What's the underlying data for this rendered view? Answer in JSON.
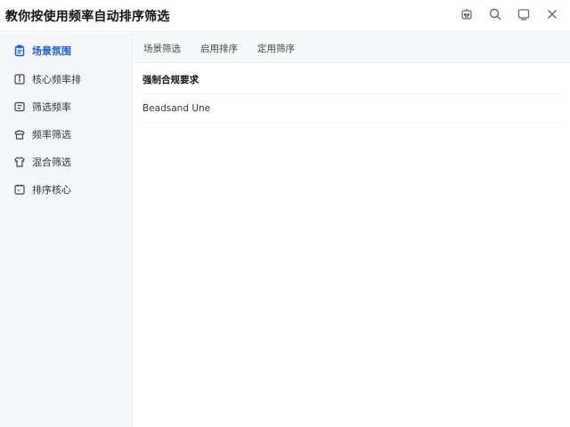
{
  "window": {
    "title": "教你按使用频率自动排序筛选"
  },
  "titlebar_icons": [
    "robot-icon",
    "search-icon",
    "window-icon",
    "close-icon"
  ],
  "sidebar": {
    "items": [
      {
        "label": "场景氛围",
        "icon": "clipboard-icon",
        "active": true
      },
      {
        "label": "核心频率排",
        "icon": "info-square-icon",
        "active": false
      },
      {
        "label": "筛选频率",
        "icon": "chat-square-icon",
        "active": false
      },
      {
        "label": "频率筛选",
        "icon": "hat-icon",
        "active": false
      },
      {
        "label": "混合筛选",
        "icon": "shirt-icon",
        "active": false
      },
      {
        "label": "排序核心",
        "icon": "calendar-icon",
        "active": false
      }
    ]
  },
  "tabs": [
    {
      "label": "场景筛选"
    },
    {
      "label": "启用排序"
    },
    {
      "label": "定用筛序"
    }
  ],
  "content": {
    "section_title": "强制合规要求",
    "row_text": "Beadsand Une"
  },
  "colors": {
    "accent": "#1f5fd6",
    "sidebar_bg": "#f4f6f9",
    "tab_bar_bg": "#f7f8fa"
  }
}
